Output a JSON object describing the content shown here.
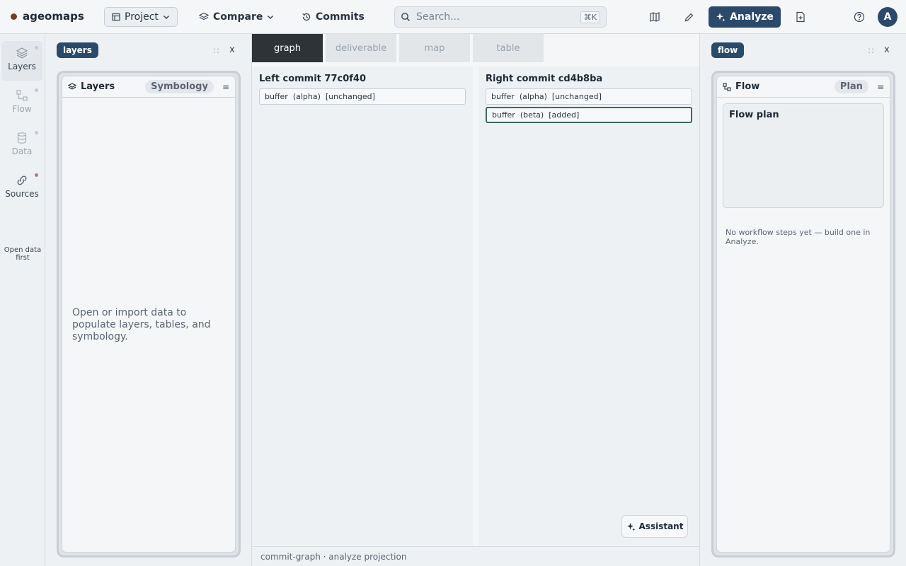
{
  "app": {
    "name": "ageomaps",
    "brand_color": "#7a3a2a"
  },
  "topbar": {
    "project_label": "Project",
    "compare_label": "Compare",
    "commits_label": "Commits",
    "search_placeholder": "Search...",
    "search_shortcut": "⌘K",
    "analyze_label": "Analyze",
    "avatar_initial": "A",
    "accent_color": "#2b4a6b"
  },
  "rail": {
    "items": [
      {
        "label": "Layers",
        "icon": "layers-icon"
      },
      {
        "label": "Flow",
        "icon": "flow-icon"
      },
      {
        "label": "Data",
        "icon": "database-icon"
      },
      {
        "label": "Sources",
        "icon": "link-icon"
      }
    ],
    "note": "Open data first"
  },
  "left_panel": {
    "pill": "layers",
    "grip": "::",
    "close": "x",
    "card_title": "Layers",
    "chip": "Symbology",
    "empty_message": "Open or import data to populate layers, tables, and symbology."
  },
  "center": {
    "tabs": [
      "graph",
      "deliverable",
      "map",
      "table"
    ],
    "active_tab": "graph",
    "left_commit": {
      "title": "Left commit 77c0f40",
      "items": [
        "buffer  (alpha)  [unchanged]"
      ]
    },
    "right_commit": {
      "title": "Right commit cd4b8ba",
      "items": [
        "buffer  (alpha)  [unchanged]",
        "buffer  (beta)  [added]"
      ]
    },
    "assistant_label": "Assistant",
    "status": "commit-graph · analyze projection"
  },
  "right_panel": {
    "pill": "flow",
    "grip": "::",
    "close": "x",
    "card_title": "Flow",
    "chip": "Plan",
    "plan_title": "Flow plan",
    "empty_message": "No workflow steps yet — build one in Analyze."
  }
}
